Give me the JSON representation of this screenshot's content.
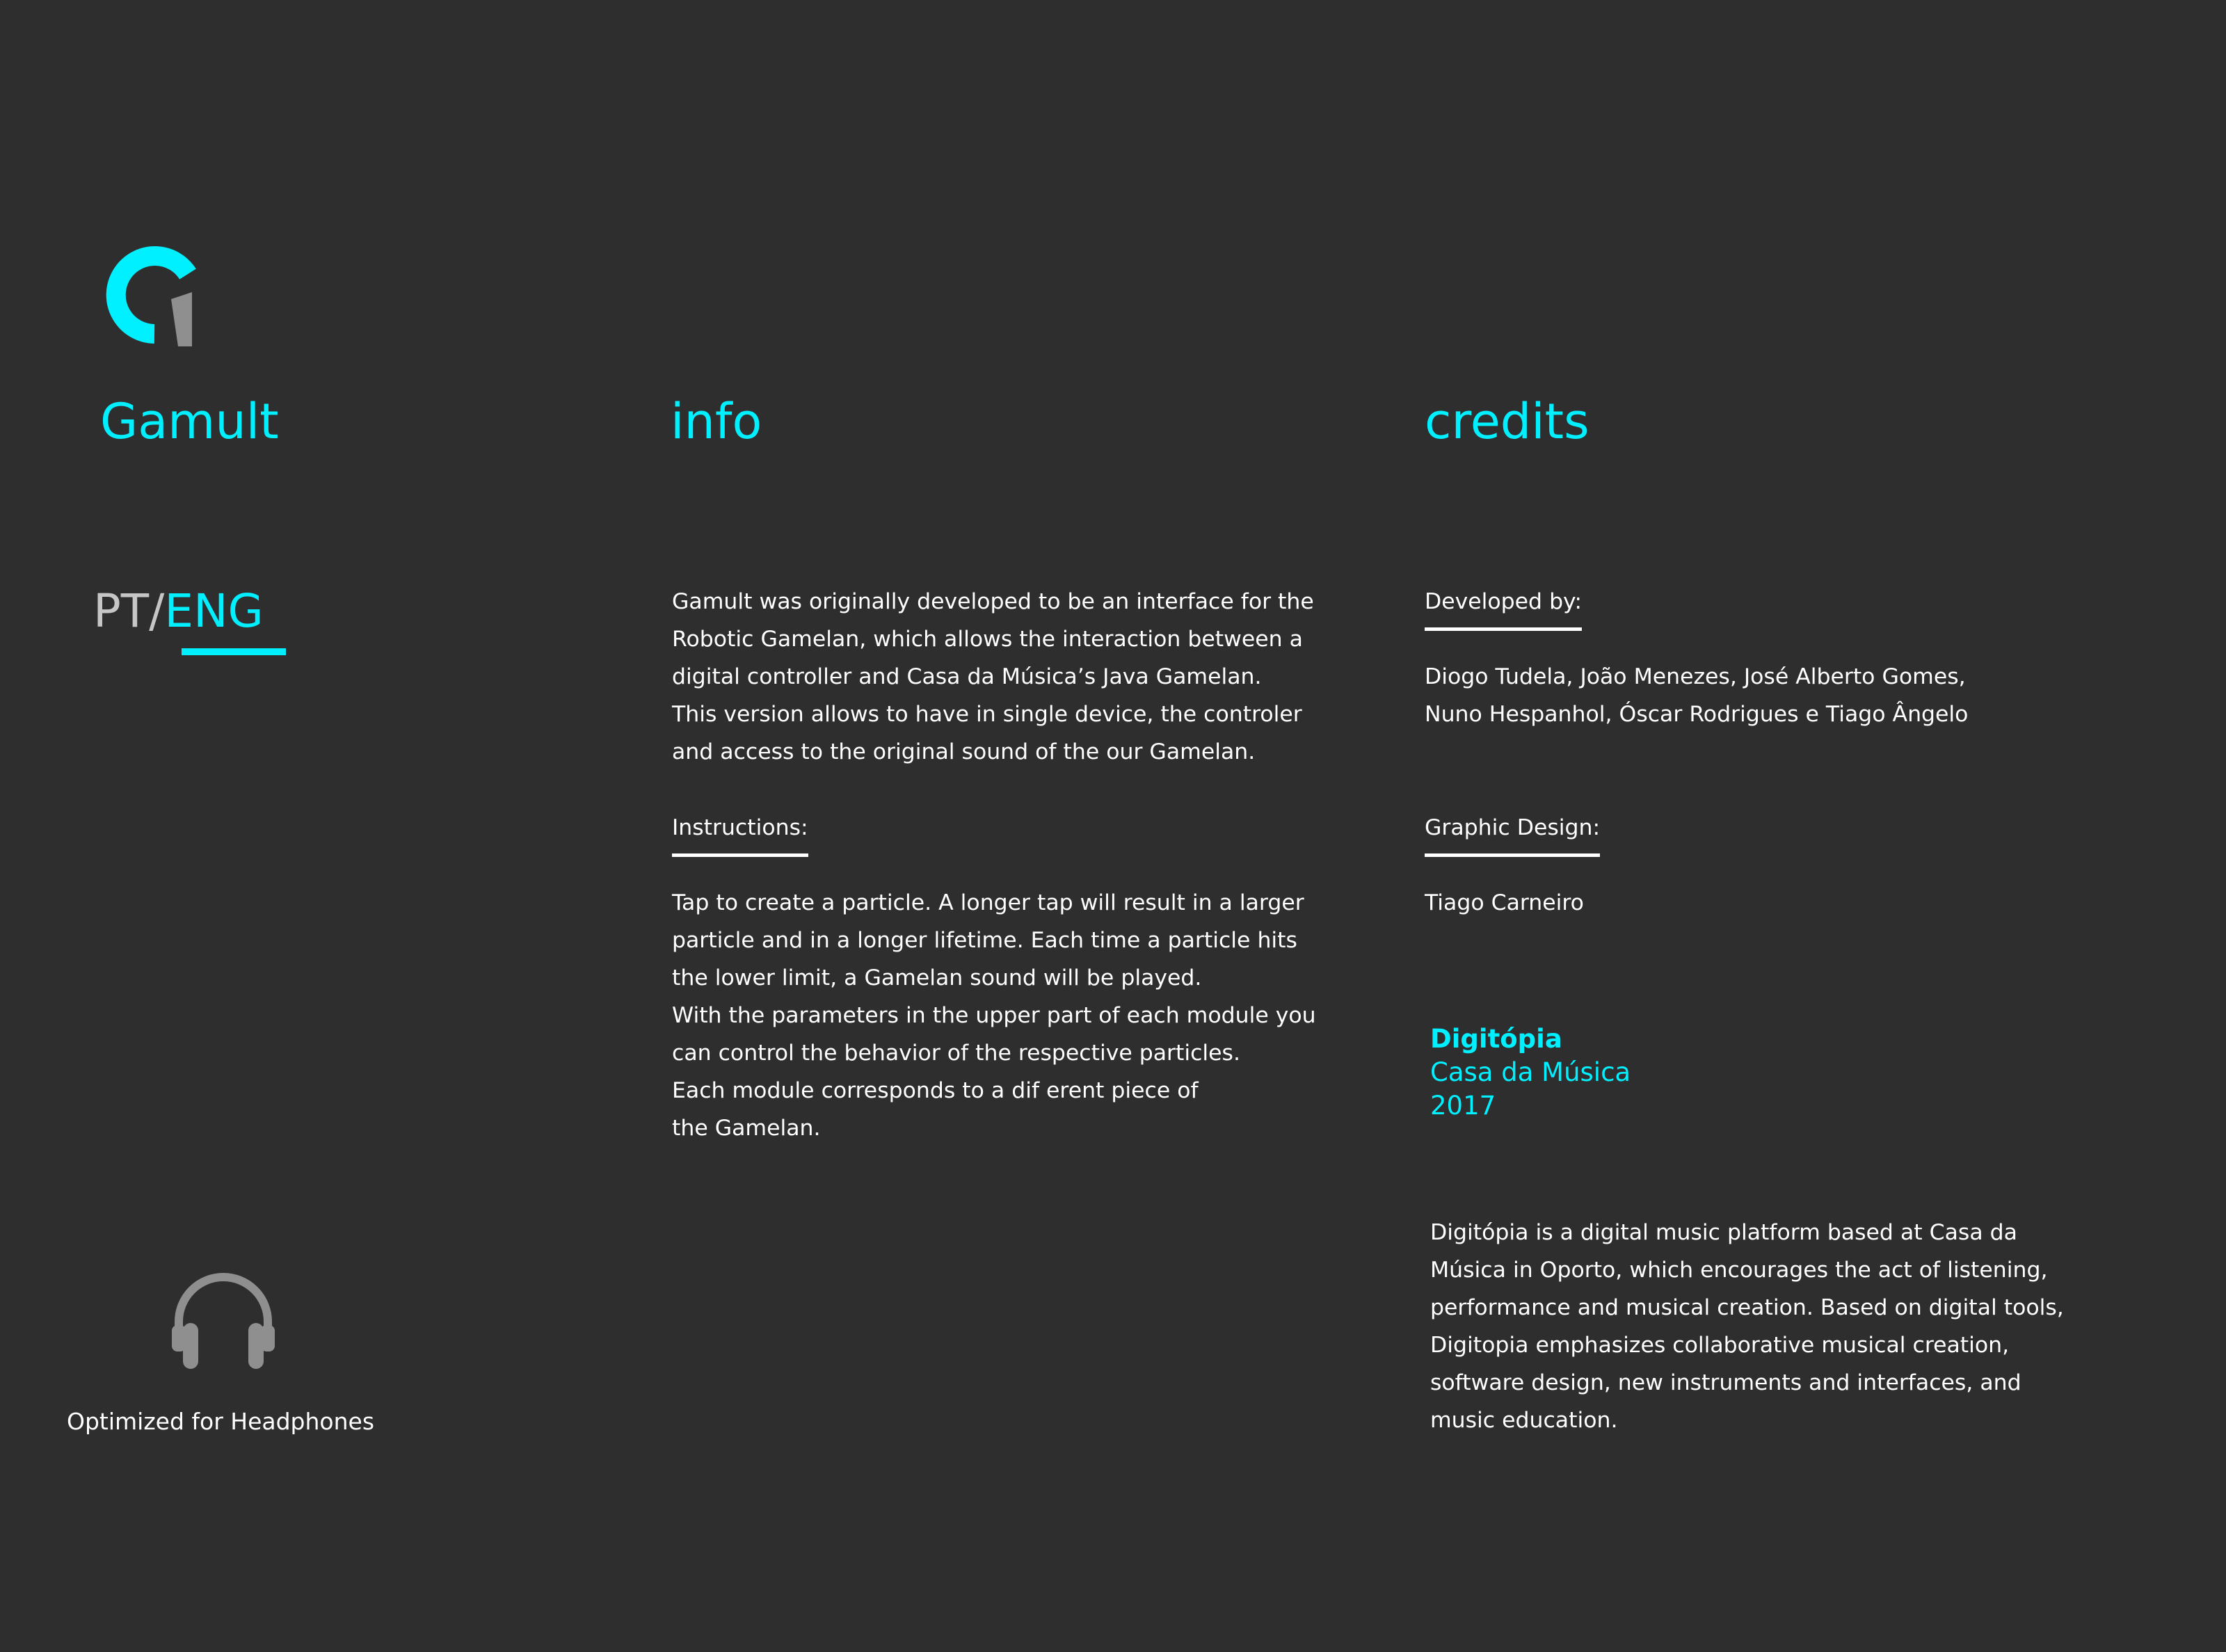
{
  "colors": {
    "background": "#2e2e2e",
    "accent": "#00f0ff",
    "text": "#ffffff",
    "muted": "#c6c6c6",
    "icon_gray": "#8f8f8f"
  },
  "icons": {
    "logo": "gamult-logo-icon",
    "headphones": "headphones-icon"
  },
  "app": {
    "title": "Gamult"
  },
  "language": {
    "pt_label": "PT",
    "separator": "/",
    "eng_label": "ENG",
    "selected": "ENG"
  },
  "info": {
    "title": "info",
    "description_lines": [
      "Gamult was originally developed to be an interface for the",
      "Robotic Gamelan, which allows the interaction between a",
      "digital controller and Casa da Música’s Java Gamelan.",
      "This version allows to have in single device, the controler",
      "and access to the original sound of the our Gamelan."
    ],
    "instructions_label": "Instructions:",
    "instructions_lines": [
      "Tap to create a particle. A longer tap will result in a larger",
      "particle and in a longer lifetime. Each time a particle hits",
      "the lower limit, a Gamelan sound will be played.",
      "With the parameters in the upper part of each module you",
      "can control the behavior of the respective particles.",
      "Each module corresponds to a dif erent piece of",
      "the Gamelan."
    ]
  },
  "credits": {
    "title": "credits",
    "developed_label": "Developed by:",
    "developers_lines": [
      "Diogo Tudela, João Menezes, José Alberto Gomes,",
      "Nuno Hespanhol, Óscar Rodrigues e Tiago Ângelo"
    ],
    "design_label": "Graphic Design:",
    "designer": "Tiago Carneiro",
    "org_name": "Digitópia",
    "org_venue": "Casa da Música",
    "year": "2017",
    "about_lines": [
      "Digitópia is a digital music platform based at Casa da",
      "Música in Oporto, which encourages the act of listening,",
      "performance and musical creation. Based on digital tools,",
      "Digitopia emphasizes collaborative musical creation,",
      "software design, new instruments and interfaces, and",
      "music education."
    ]
  },
  "footer": {
    "headphones_label": "Optimized for Headphones"
  }
}
